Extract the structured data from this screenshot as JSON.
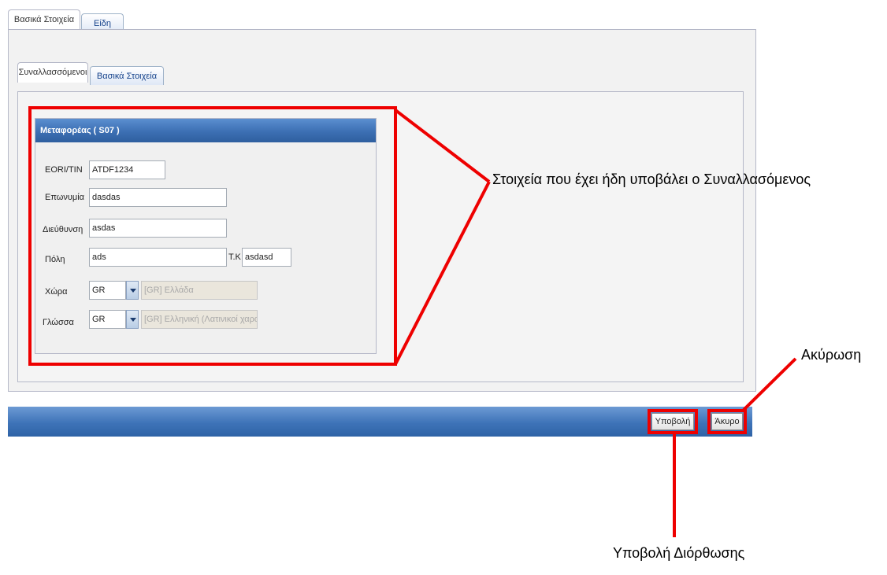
{
  "tabs_outer": [
    {
      "label": "Βασικά Στοιχεία",
      "active": true
    },
    {
      "label": "Είδη",
      "active": false
    }
  ],
  "tabs_inner": [
    {
      "label": "Συναλλασσόμενοι",
      "active": true
    },
    {
      "label": "Βασικά Στοιχεία",
      "active": false
    }
  ],
  "fieldset": {
    "title": "Μεταφορέας ( S07 )",
    "eori_label": "EORI/TIN",
    "eori_value": "ATDF1234",
    "name_label": "Επωνυμία",
    "name_value": "dasdas",
    "address_label": "Διεύθυνση",
    "address_value": "asdas",
    "city_label": "Πόλη",
    "city_value": "ads",
    "zip_label": "T.K",
    "zip_value": "asdasd",
    "country_label": "Χώρα",
    "country_code": "GR",
    "country_desc": "[GR] Ελλάδα",
    "lang_label": "Γλώσσα",
    "lang_code": "GR",
    "lang_desc": "[GR] Ελληνική (Λατινικοί χαρακτήρες)"
  },
  "buttons": {
    "submit": "Υποβολή",
    "cancel": "Άκυρο"
  },
  "annotations": {
    "fieldset_note": "Στοιχεία που έχει ήδη υποβάλει ο Συναλλασόμενος",
    "cancel_note": "Ακύρωση",
    "submit_note": "Υποβολή Διόρθωσης"
  },
  "colors": {
    "highlight": "#ee0000",
    "header_blue": "#3c6fb3"
  }
}
